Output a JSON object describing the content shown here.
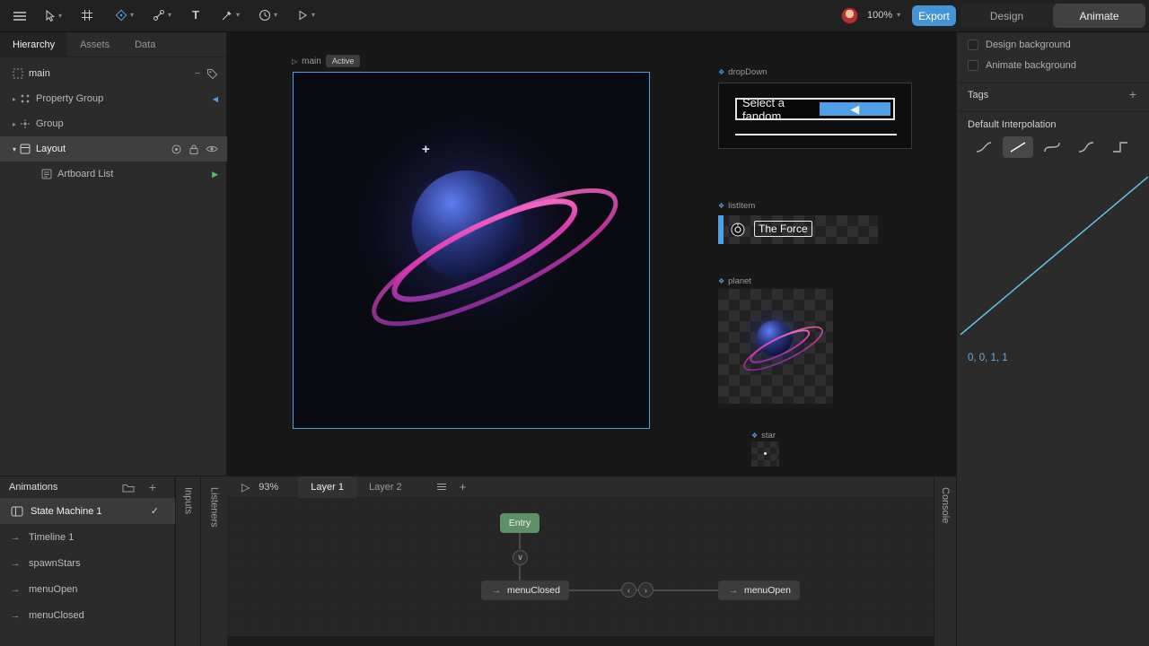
{
  "icons": {
    "caret_down": "▾",
    "caret_right": "▸",
    "check": "✓",
    "arrow_right": "→",
    "plus": "+",
    "minus": "−",
    "chevron_down": "∨",
    "chevron_left": "‹",
    "chevron_right": "›",
    "play_outline": "▷",
    "crosshair": "+",
    "component_marker": "❖",
    "dropdown_arrow": "◀",
    "scroll_to": "◀",
    "play_green": "▶",
    "text_tool": "T"
  },
  "toolbar": {
    "zoom_value": "100%",
    "export_label": "Export",
    "design_label": "Design",
    "animate_label": "Animate"
  },
  "hierarchy_panel": {
    "tabs": [
      {
        "label": "Hierarchy"
      },
      {
        "label": "Assets"
      },
      {
        "label": "Data"
      }
    ],
    "artboard_row": {
      "label": "main"
    },
    "rows": [
      {
        "label": "Property Group"
      },
      {
        "label": "Group"
      },
      {
        "label": "Layout"
      },
      {
        "label": "Artboard List"
      }
    ]
  },
  "animations_panel": {
    "title": "Animations",
    "items": [
      {
        "label": "State Machine 1"
      },
      {
        "label": "Timeline 1"
      },
      {
        "label": "spawnStars"
      },
      {
        "label": "menuOpen"
      },
      {
        "label": "menuClosed"
      }
    ]
  },
  "dock_tabs": {
    "inputs": "Inputs",
    "listeners": "Listeners",
    "console": "Console"
  },
  "stage": {
    "artboard_label": "main",
    "active_badge": "Active",
    "dropdown": {
      "name": "dropDown",
      "value": "Select a fandom"
    },
    "list_item": {
      "name": "listItem",
      "text": "The Force"
    },
    "planet": {
      "name": "planet"
    },
    "star": {
      "name": "star"
    }
  },
  "inspector": {
    "design_background_label": "Design background",
    "animate_background_label": "Animate background",
    "tags_label": "Tags",
    "interpolation_label": "Default Interpolation",
    "curve_values": "0, 0, 1, 1"
  },
  "state_machine": {
    "zoom_value": "93%",
    "tabs": [
      {
        "label": "Layer 1"
      },
      {
        "label": "Layer 2"
      }
    ],
    "entry_node": "Entry",
    "closed_node": "menuClosed",
    "open_node": "menuOpen"
  },
  "colors": {
    "accent_blue": "#4f9ee8",
    "export_blue": "#4494d6",
    "entry_green": "#5e9065",
    "ring_pink": "#d838ae",
    "curve_line": "#62c2e8"
  }
}
